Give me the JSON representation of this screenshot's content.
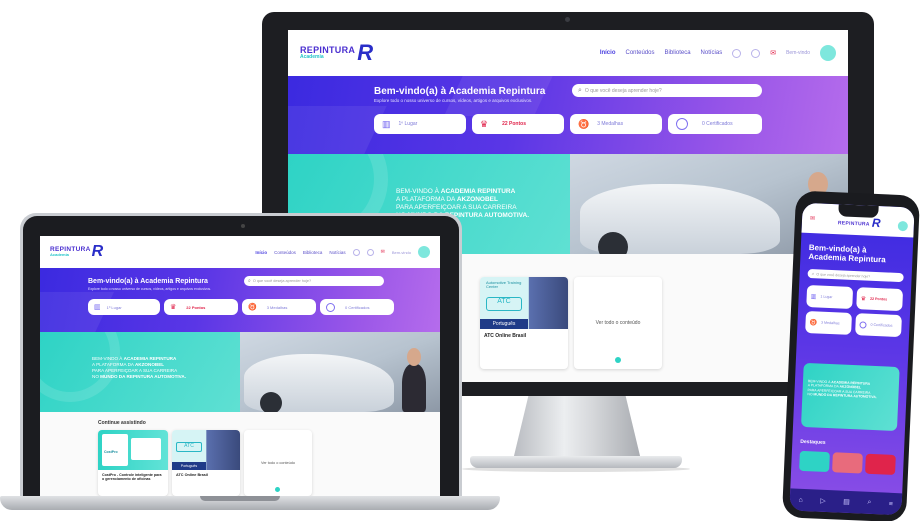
{
  "brand": {
    "logo_line1": "REPINTURA",
    "logo_line2": "Academia",
    "logo_mark": "R"
  },
  "nav": {
    "items": [
      "Início",
      "Conteúdos",
      "Biblioteca",
      "Notícias"
    ],
    "user_label": "Bem-vindo"
  },
  "hero": {
    "title": "Bem-vindo(a) à Academia Repintura",
    "subtitle": "Explore todo o nosso universo de cursos, vídeos, artigos e arquivos exclusivos.",
    "search_placeholder": "O que você deseja aprender hoje?",
    "stats": [
      {
        "label": "1º Lugar",
        "icon": "ranking-chart-icon",
        "accent": false
      },
      {
        "label": "22 Pontos",
        "icon": "trophy-icon",
        "accent": true
      },
      {
        "label": "3 Medalhas",
        "icon": "medal-icon",
        "accent": false
      },
      {
        "label": "0 Certificados",
        "icon": "certificate-icon",
        "accent": false
      }
    ]
  },
  "banner": {
    "line1_a": "BEM-VINDO À",
    "line1_b": "ACADEMIA REPINTURA",
    "line2_a": "A PLATAFORMA DA",
    "line2_b": "AKZONOBEL",
    "line3": "PARA APERFEIÇOAR A SUA CARREIRA",
    "line4_a": "NO",
    "line4_b": "MUNDO DA REPINTURA AUTOMOTIVA."
  },
  "continue": {
    "title": "Continue assistindo",
    "cards": [
      {
        "title": "CostPro - Controle inteligente para o gerenciamento de oficinas",
        "image_caption": "CostPro"
      },
      {
        "title": "ATC Online Brasil",
        "image_caption": "Português",
        "image_header": "Automotive Training Center"
      }
    ],
    "see_all": "Ver todo o conteúdo"
  },
  "phone": {
    "title_line1": "Bem-vindo(a) à",
    "title_line2": "Academia Repintura",
    "search_placeholder": "O que você deseja aprender hoje?",
    "stats": [
      "1 Lugar",
      "22 Pontos",
      "3 Medalhas",
      "0 Certificados"
    ],
    "section": "Destaques"
  },
  "colors": {
    "primary": "#4a2fd0",
    "teal": "#2ed3c5",
    "accent_red": "#e0244b"
  }
}
